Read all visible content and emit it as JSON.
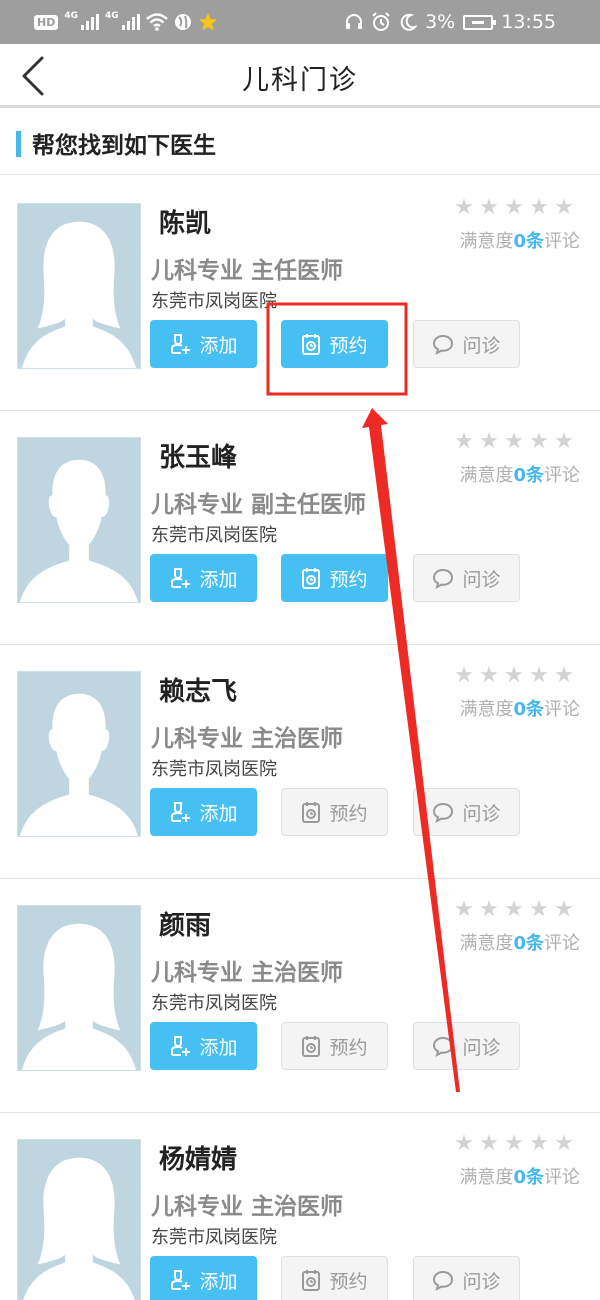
{
  "status_bar": {
    "hd_label": "HD",
    "net1": "4G",
    "net2": "4G",
    "battery_percent": "3%",
    "time": "13:55",
    "icons": [
      "signal-icon",
      "wifi-icon",
      "alarm-icon",
      "moon-icon",
      "battery-icon"
    ]
  },
  "header": {
    "title": "儿科门诊",
    "back_icon": "chevron-left-icon"
  },
  "section": {
    "title": "帮您找到如下医生",
    "accent_color": "#46b8ec"
  },
  "labels": {
    "add": "添加",
    "book": "预约",
    "consult": "问诊",
    "satisfaction_prefix": "满意度",
    "satisfaction_suffix": "评论"
  },
  "doctors": [
    {
      "name": "陈凯",
      "title": "儿科专业 主任医师",
      "hospital": "东莞市凤岗医院",
      "review_count": "0条",
      "stars": 0,
      "booking_available": true,
      "avatar": "female"
    },
    {
      "name": "张玉峰",
      "title": "儿科专业 副主任医师",
      "hospital": "东莞市凤岗医院",
      "review_count": "0条",
      "stars": 0,
      "booking_available": true,
      "avatar": "male"
    },
    {
      "name": "赖志飞",
      "title": "儿科专业 主治医师",
      "hospital": "东莞市凤岗医院",
      "review_count": "0条",
      "stars": 0,
      "booking_available": false,
      "avatar": "male"
    },
    {
      "name": "颜雨",
      "title": "儿科专业 主治医师",
      "hospital": "东莞市凤岗医院",
      "review_count": "0条",
      "stars": 0,
      "booking_available": false,
      "avatar": "female"
    },
    {
      "name": "杨婧婧",
      "title": "儿科专业 主治医师",
      "hospital": "东莞市凤岗医院",
      "review_count": "0条",
      "stars": 0,
      "booking_available": false,
      "avatar": "female"
    }
  ],
  "colors": {
    "primary_button": "#46bff2",
    "disabled_button": "#f4f4f4",
    "annotation_red": "#ee2a24"
  }
}
